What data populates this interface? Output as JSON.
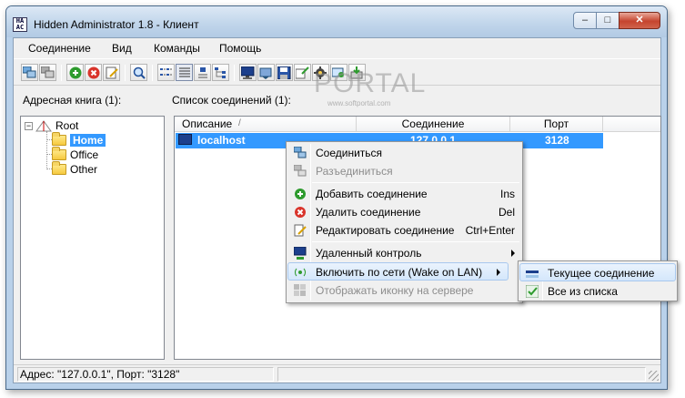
{
  "window": {
    "title": "Hidden Administrator 1.8 - Клиент",
    "app_icon_text": "HA\nAC",
    "controls": {
      "minimize": "–",
      "maximize": "□",
      "close": "✕"
    }
  },
  "menubar": {
    "items": [
      "Соединение",
      "Вид",
      "Команды",
      "Помощь"
    ]
  },
  "toolbar": {
    "icons": [
      "connect-icon",
      "disconnect-icon",
      "add-icon",
      "delete-icon",
      "edit-icon",
      "search-icon",
      "view-small-icons-icon",
      "view-list-icon",
      "view-large-icons-icon",
      "view-tree-icon",
      "remote-control-icon",
      "screenshot-icon",
      "file-manager-icon",
      "processes-icon",
      "network-icon",
      "settings-icon",
      "download-icon"
    ]
  },
  "watermark": {
    "text": "PORTAL",
    "sub": "www.softportal.com"
  },
  "address_book": {
    "label": "Адресная книга (1):",
    "root": "Root",
    "folders": [
      "Home",
      "Office",
      "Other"
    ],
    "selected": "Home"
  },
  "connections": {
    "label": "Список соединений (1):",
    "columns": [
      "Описание",
      "Соединение",
      "Порт"
    ],
    "sort_indicator": "/",
    "rows": [
      {
        "description": "localhost",
        "connection": "127.0.0.1",
        "port": "3128"
      }
    ]
  },
  "context_menu": {
    "items": [
      {
        "label": "Соединиться",
        "shortcut": "",
        "icon": "connect-icon",
        "enabled": true
      },
      {
        "label": "Разъединиться",
        "shortcut": "",
        "icon": "disconnect-icon",
        "enabled": false
      },
      {
        "label": "Добавить соединение",
        "shortcut": "Ins",
        "icon": "add-icon",
        "enabled": true
      },
      {
        "label": "Удалить соединение",
        "shortcut": "Del",
        "icon": "delete-icon",
        "enabled": true
      },
      {
        "label": "Редактировать соединение",
        "shortcut": "Ctrl+Enter",
        "icon": "edit-icon",
        "enabled": true
      },
      {
        "label": "Удаленный контроль",
        "shortcut": "",
        "icon": "remote-control-icon",
        "enabled": true
      },
      {
        "label": "Включить по сети (Wake on LAN)",
        "shortcut": "",
        "icon": "wake-on-lan-icon",
        "enabled": true
      },
      {
        "label": "Отображать иконку на сервере",
        "shortcut": "",
        "icon": "show-server-icon",
        "enabled": false
      }
    ]
  },
  "submenu": {
    "items": [
      {
        "label": "Текущее соединение",
        "icon": "current-connection-icon"
      },
      {
        "label": "Все из списка",
        "icon": "checkmark-icon"
      }
    ]
  },
  "status": {
    "text": "Адрес: \"127.0.0.1\", Порт: \"3128\""
  },
  "colors": {
    "selection": "#3399ff",
    "menu_highlight": "#d4e7fb",
    "close_button": "#c5442e"
  }
}
